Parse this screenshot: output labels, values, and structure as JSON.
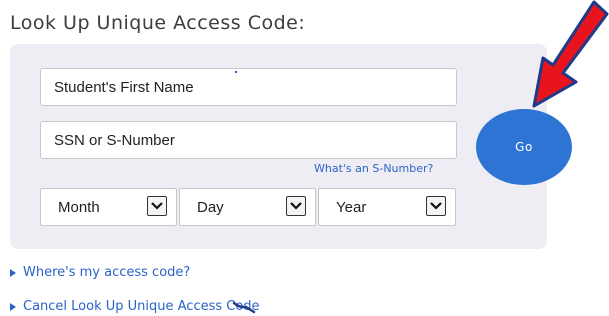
{
  "heading": "Look Up Unique Access Code:",
  "form": {
    "first_name_placeholder": "Student's First Name",
    "ssn_placeholder": "SSN or S-Number",
    "s_number_help": "What's an S-Number?",
    "month_label": "Month",
    "day_label": "Day",
    "year_label": "Year",
    "go_label": "Go"
  },
  "links": {
    "where_code": "Where's my access code?",
    "cancel": "Cancel Look Up Unique Access Code"
  },
  "colors": {
    "accent": "#2e74d4",
    "link": "#2b63c6",
    "panel": "#eeedf3",
    "annotation_arrow": "#e8141c"
  },
  "icons": {
    "dropdown": "chevron-down-icon",
    "annotation": "red-arrow-icon",
    "link_marker": "triangle-right-icon"
  }
}
